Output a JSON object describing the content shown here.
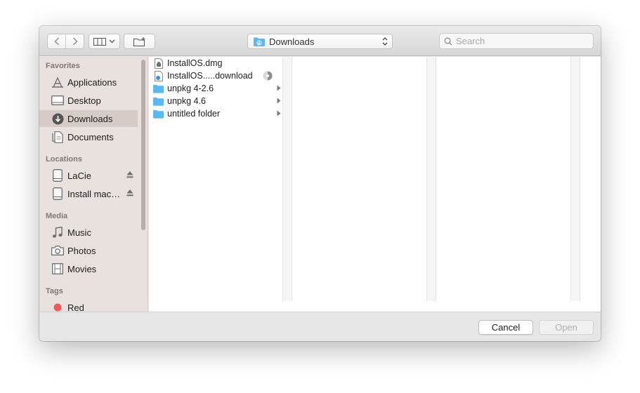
{
  "toolbar": {
    "location_label": "Downloads",
    "search_placeholder": "Search"
  },
  "sidebar": {
    "sections": {
      "favorites": "Favorites",
      "locations": "Locations",
      "media": "Media",
      "tags": "Tags"
    },
    "favorites": [
      {
        "label": "Applications",
        "icon": "applications-icon"
      },
      {
        "label": "Desktop",
        "icon": "desktop-icon"
      },
      {
        "label": "Downloads",
        "icon": "downloads-icon",
        "selected": true
      },
      {
        "label": "Documents",
        "icon": "documents-icon"
      }
    ],
    "locations": [
      {
        "label": "LaCie",
        "icon": "drive-icon"
      },
      {
        "label": "Install mac…",
        "icon": "drive-icon"
      }
    ],
    "media": [
      {
        "label": "Music",
        "icon": "music-icon"
      },
      {
        "label": "Photos",
        "icon": "camera-icon"
      },
      {
        "label": "Movies",
        "icon": "film-icon"
      }
    ],
    "tags": [
      {
        "label": "Red",
        "color": "#f05a57"
      }
    ]
  },
  "files": [
    {
      "name": "InstallOS.dmg",
      "icon": "disk-image-icon"
    },
    {
      "name": "InstallOS.....download",
      "icon": "download-file-icon",
      "in_progress": true
    },
    {
      "name": "unpkg 4-2.6",
      "icon": "folder-icon",
      "has_children": true
    },
    {
      "name": "unpkg 4.6",
      "icon": "folder-icon",
      "has_children": true
    },
    {
      "name": "untitled folder",
      "icon": "folder-icon",
      "has_children": true
    }
  ],
  "buttons": {
    "cancel": "Cancel",
    "open": "Open"
  },
  "colors": {
    "folder": "#5ab9f4",
    "sidebar_bg": "#e9e1dd",
    "tag_red": "#f05a57"
  }
}
